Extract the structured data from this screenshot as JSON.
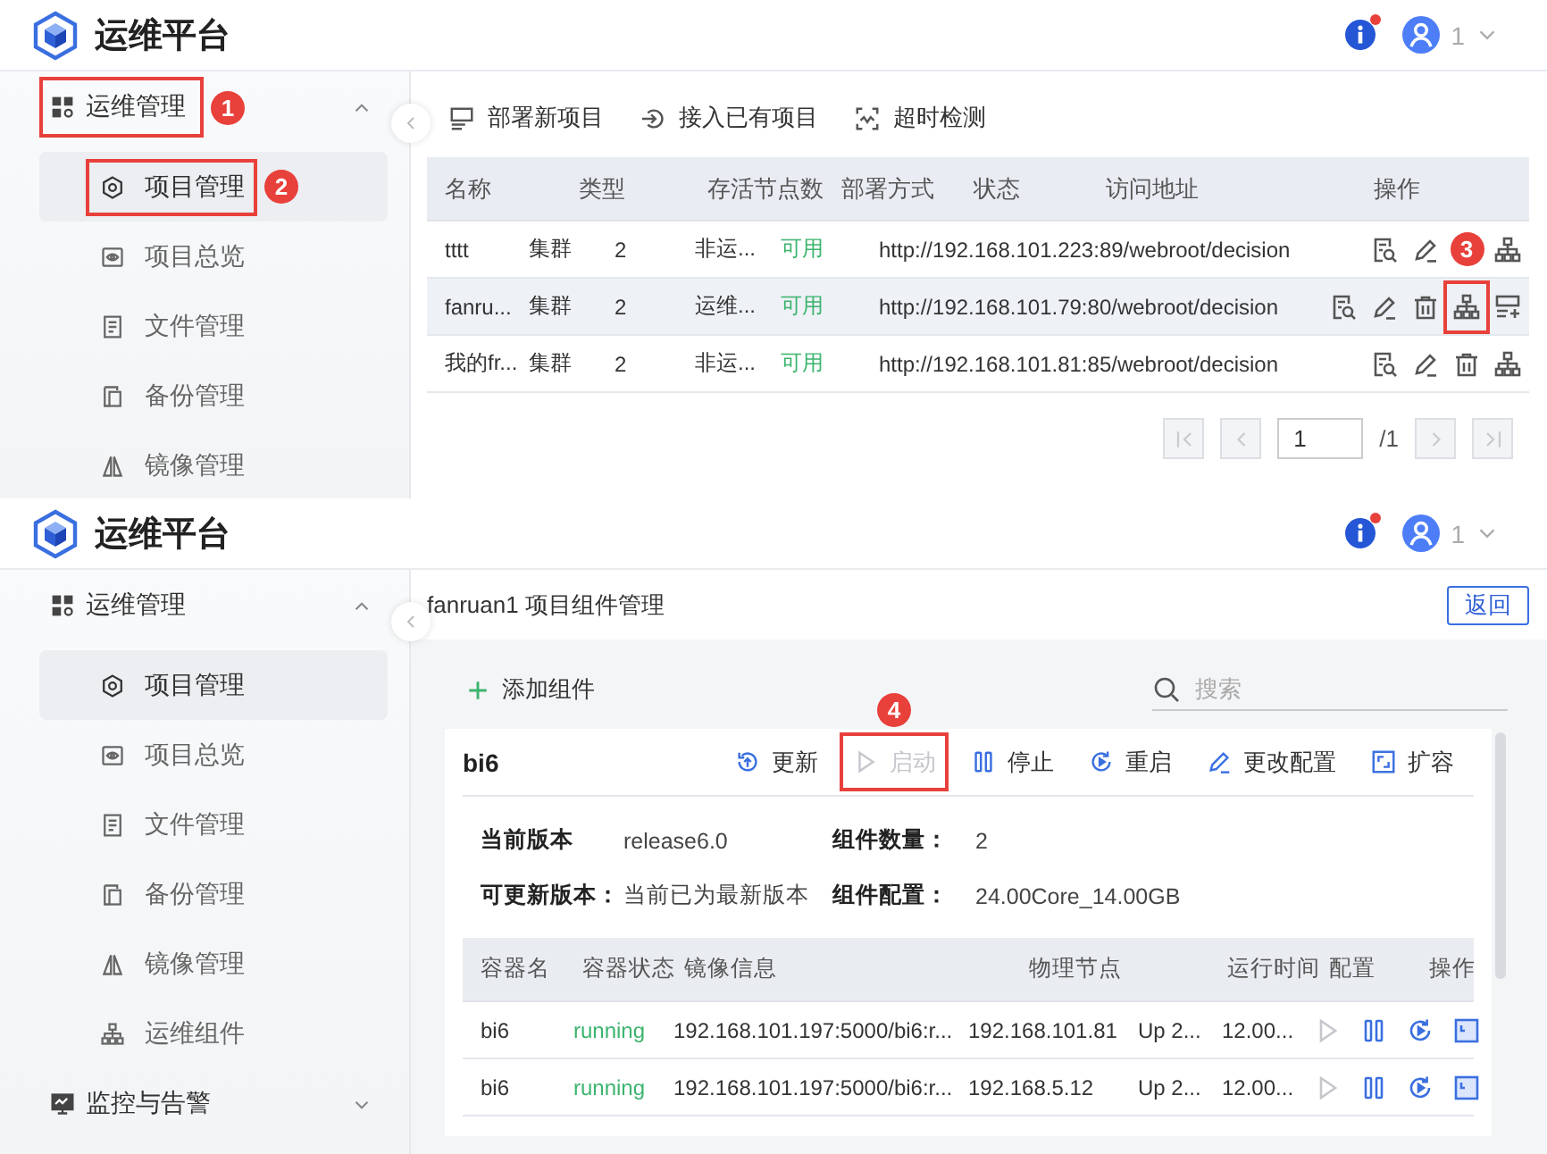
{
  "project_list": {
    "header": {
      "title": "运维平台",
      "notice": true,
      "user": "1"
    },
    "sidebar": {
      "groups": [
        {
          "label": "运维管理",
          "expanded": true,
          "marker": "1",
          "children": [
            {
              "label": "项目管理",
              "selected": true,
              "marker": "2"
            },
            {
              "label": "项目总览",
              "selected": false
            },
            {
              "label": "文件管理",
              "selected": false
            },
            {
              "label": "备份管理",
              "selected": false
            },
            {
              "label": "镜像管理",
              "selected": false
            }
          ]
        }
      ]
    },
    "toolbar": [
      {
        "kind": "deploy_new",
        "label": "部署新项目"
      },
      {
        "kind": "import",
        "label": "接入已有项目"
      },
      {
        "kind": "timeout_check",
        "label": "超时检测"
      }
    ],
    "table": {
      "columns": [
        "名称",
        "类型",
        "存活节点数",
        "部署方式",
        "状态",
        "访问地址",
        "操作"
      ],
      "rows": [
        {
          "highlighted": false,
          "name": "tttt",
          "type": "集群",
          "alive_nodes": "2",
          "deploy_mode": "非运...",
          "status": {
            "text": "可用",
            "color": "#3cb46e"
          },
          "url": "http://192.168.101.223:89/webroot/decision",
          "ops": [
            {
              "kind": "view"
            },
            {
              "kind": "edit"
            },
            {
              "kind": "deploy"
            }
          ]
        },
        {
          "highlighted": true,
          "name": "fanru...",
          "type": "集群",
          "alive_nodes": "2",
          "deploy_mode": "运维...",
          "status": {
            "text": "可用",
            "color": "#3cb46e"
          },
          "url": "http://192.168.101.79:80/webroot/decision",
          "ops": [
            {
              "kind": "view"
            },
            {
              "kind": "edit"
            },
            {
              "kind": "delete"
            },
            {
              "kind": "deploy",
              "marker": "3"
            },
            {
              "kind": "add"
            }
          ]
        },
        {
          "highlighted": false,
          "name": "我的fr...",
          "type": "集群",
          "alive_nodes": "2",
          "deploy_mode": "非运...",
          "status": {
            "text": "可用",
            "color": "#3cb46e"
          },
          "url": "http://192.168.101.81:85/webroot/decision",
          "ops": [
            {
              "kind": "view"
            },
            {
              "kind": "edit"
            },
            {
              "kind": "delete"
            },
            {
              "kind": "deploy"
            }
          ]
        }
      ]
    },
    "pagination": {
      "before": [
        {
          "kind": "first",
          "disabled": true
        },
        {
          "kind": "prev",
          "disabled": true
        }
      ],
      "page": "1",
      "total": "/1",
      "after": [
        {
          "kind": "next",
          "disabled": true
        },
        {
          "kind": "last",
          "disabled": true
        }
      ]
    }
  },
  "component_detail": {
    "header": {
      "title": "运维平台",
      "notice": true,
      "user": "1"
    },
    "sidebar": {
      "groups": [
        {
          "label": "运维管理",
          "expanded": true,
          "children": [
            {
              "label": "项目管理",
              "selected": true
            },
            {
              "label": "项目总览",
              "selected": false
            },
            {
              "label": "文件管理",
              "selected": false
            },
            {
              "label": "备份管理",
              "selected": false
            },
            {
              "label": "镜像管理",
              "selected": false
            },
            {
              "label": "运维组件",
              "selected": false
            }
          ]
        },
        {
          "label": "监控与告警",
          "expanded": false
        }
      ]
    },
    "title": "fanruan1 项目组件管理",
    "back_button": "返回",
    "add_button": "添加组件",
    "search": {
      "placeholder": "搜索"
    },
    "component": {
      "name": "bi6",
      "actions": [
        {
          "kind": "update",
          "label": "更新",
          "disabled": false
        },
        {
          "kind": "start",
          "label": "启动",
          "disabled": true,
          "marker": "4"
        },
        {
          "kind": "stop",
          "label": "停止",
          "disabled": false
        },
        {
          "kind": "restart",
          "label": "重启",
          "disabled": false
        },
        {
          "kind": "config",
          "label": "更改配置",
          "disabled": false
        },
        {
          "kind": "expand",
          "label": "扩容",
          "disabled": false
        }
      ],
      "info": [
        {
          "label": "当前版本",
          "value": "release6.0"
        },
        {
          "label": "组件数量：",
          "value": "2"
        },
        {
          "label": "可更新版本：",
          "value": "当前已为最新版本"
        },
        {
          "label": "组件配置：",
          "value": "24.00Core_14.00GB"
        }
      ],
      "containers": {
        "columns": [
          "容器名",
          "容器状态",
          "镜像信息",
          "物理节点",
          "运行时间",
          "配置",
          "操作"
        ],
        "rows": [
          {
            "name": "bi6",
            "status": {
              "text": "running",
              "color": "#3cb46e"
            },
            "image": "192.168.101.197:5000/bi6:r...",
            "node": "192.168.101.81",
            "uptime": "Up 2...",
            "config": "12.00...",
            "ops": [
              {
                "kind": "start",
                "disabled": true
              },
              {
                "kind": "stop",
                "disabled": false
              },
              {
                "kind": "restart",
                "disabled": false
              },
              {
                "kind": "console",
                "disabled": false
              }
            ]
          },
          {
            "name": "bi6",
            "status": {
              "text": "running",
              "color": "#3cb46e"
            },
            "image": "192.168.101.197:5000/bi6:r...",
            "node": "192.168.5.12",
            "uptime": "Up 2...",
            "config": "12.00...",
            "ops": [
              {
                "kind": "start",
                "disabled": true
              },
              {
                "kind": "stop",
                "disabled": false
              },
              {
                "kind": "restart",
                "disabled": false
              },
              {
                "kind": "console",
                "disabled": false
              }
            ]
          }
        ]
      }
    }
  }
}
